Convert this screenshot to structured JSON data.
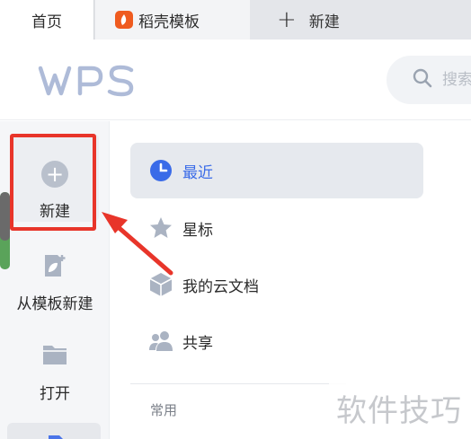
{
  "tabs": {
    "home": "首页",
    "template": "稻壳模板",
    "new_tab": "新建"
  },
  "header": {
    "logo_text": "WPS",
    "search_placeholder": "搜索"
  },
  "left_nav": {
    "new": "新建",
    "from_template": "从模板新建",
    "open": "打开"
  },
  "categories": {
    "recent": "最近",
    "starred": "星标",
    "cloud_docs": "我的云文档",
    "shared": "共享"
  },
  "section_label": "常用",
  "watermark": "软件技巧",
  "colors": {
    "accent_blue": "#3a6be8",
    "highlight_red": "#e8352a",
    "brand_orange": "#ef5b1f"
  }
}
